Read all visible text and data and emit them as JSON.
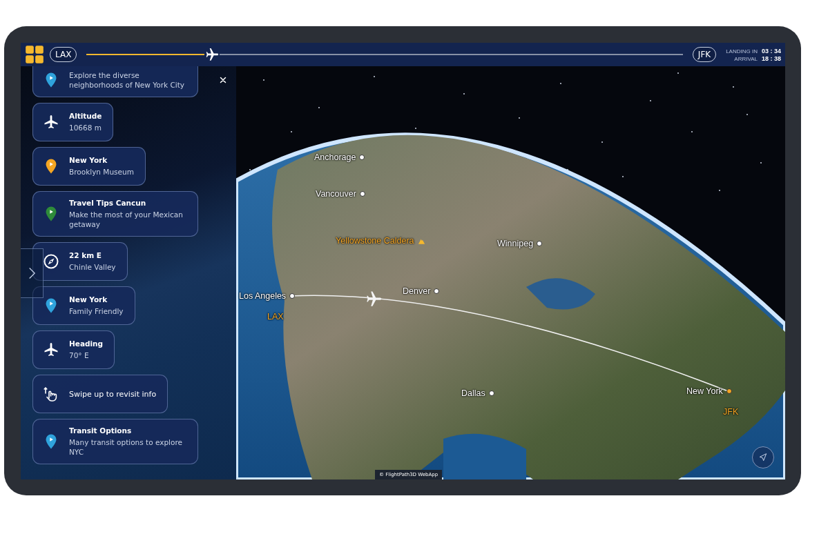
{
  "top_bar": {
    "origin": "LAX",
    "destination": "JFK",
    "progress": {
      "level": 0.21
    },
    "stats": [
      {
        "label": "LANDING IN",
        "value": "03 : 34"
      },
      {
        "label": "ARRIVAL",
        "value": "18 : 38"
      }
    ]
  },
  "cards": [
    {
      "kind": "pin",
      "color": "#2fa3dc",
      "subtitle": "Explore the diverse neighborhoods of New York City"
    },
    {
      "kind": "plane",
      "title": "Altitude",
      "subtitle": "10668 m"
    },
    {
      "kind": "pin",
      "color": "#f5a623",
      "title": "New York",
      "subtitle": "Brooklyn Museum"
    },
    {
      "kind": "pin",
      "color": "#2e8b3a",
      "title": "Travel Tips Cancun",
      "subtitle": "Make the most of your Mexican getaway"
    },
    {
      "kind": "compass",
      "title": "22 km E",
      "subtitle": "Chinle Valley"
    },
    {
      "kind": "pin",
      "color": "#2fa3dc",
      "title": "New York",
      "subtitle": "Family Friendly"
    },
    {
      "kind": "plane",
      "title": "Heading",
      "subtitle": "70° E"
    },
    {
      "kind": "swipe",
      "title": "Swipe up to revisit info"
    },
    {
      "kind": "pin",
      "color": "#2fa3dc",
      "title": "Transit Options",
      "subtitle": "Many transit options to explore NYC"
    }
  ],
  "map": {
    "labels": [
      {
        "kind": "city",
        "text": "Anchorage",
        "color": "#ffffff"
      },
      {
        "kind": "city",
        "text": "Vancouver",
        "color": "#ffffff"
      },
      {
        "kind": "landmark",
        "text": "Yellowstone Caldera"
      },
      {
        "kind": "city",
        "text": "Winnipeg",
        "color": "#ffffff"
      },
      {
        "kind": "city",
        "text": "Los Angeles",
        "color": "#ffffff"
      },
      {
        "kind": "airport",
        "text": "LAX"
      },
      {
        "kind": "city",
        "text": "Denver",
        "color": "#ffffff"
      },
      {
        "kind": "city",
        "text": "Dallas",
        "color": "#ffffff"
      },
      {
        "kind": "city",
        "text": "New York",
        "color": "#f5a623"
      },
      {
        "kind": "airport",
        "text": "JFK"
      }
    ],
    "attribution": "© FlightPath3D WebApp"
  }
}
